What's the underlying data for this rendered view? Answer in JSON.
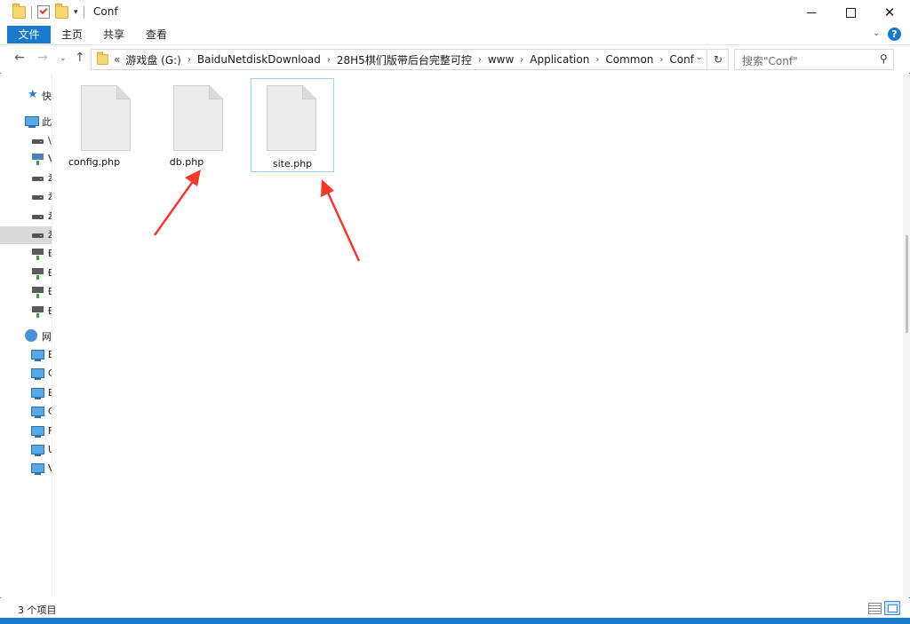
{
  "window": {
    "title": "Conf"
  },
  "ribbon": {
    "file_tab": "文件",
    "tabs": [
      "主页",
      "共享",
      "查看"
    ],
    "help": "?"
  },
  "nav": {
    "breadcrumbs": [
      "游戏盘 (G:)",
      "BaiduNetdiskDownload",
      "28H5棋们版带后台完整可控",
      "www",
      "Application",
      "Common",
      "Conf"
    ],
    "prefix": "«"
  },
  "search": {
    "placeholder": "搜索\"Conf\""
  },
  "sidebar": {
    "items": [
      {
        "label": "快",
        "icon": "star-icon"
      },
      {
        "label": "此",
        "icon": "computer-icon"
      },
      {
        "label": "\\",
        "icon": "drive-icon"
      },
      {
        "label": "V",
        "icon": "drive-icon"
      },
      {
        "label": "ž",
        "icon": "drive-icon"
      },
      {
        "label": "ž",
        "icon": "drive-icon"
      },
      {
        "label": "ž",
        "icon": "drive-icon"
      },
      {
        "label": "ž",
        "icon": "drive-icon"
      },
      {
        "label": "Ð",
        "icon": "network-drive-icon"
      },
      {
        "label": "Ð",
        "icon": "network-drive-icon"
      },
      {
        "label": "Ð",
        "icon": "network-drive-icon"
      },
      {
        "label": "Ð",
        "icon": "network-drive-icon"
      },
      {
        "label": "网",
        "icon": "network-icon"
      },
      {
        "label": "E",
        "icon": "monitor-icon"
      },
      {
        "label": "C",
        "icon": "monitor-icon"
      },
      {
        "label": "E",
        "icon": "monitor-icon"
      },
      {
        "label": "C",
        "icon": "monitor-icon"
      },
      {
        "label": "F",
        "icon": "monitor-icon"
      },
      {
        "label": "U",
        "icon": "monitor-icon"
      },
      {
        "label": "V",
        "icon": "monitor-icon"
      }
    ]
  },
  "files": [
    {
      "name": "config.php"
    },
    {
      "name": "db.php"
    },
    {
      "name": "site.php"
    }
  ],
  "status": {
    "text": "3 个项目"
  },
  "colors": {
    "accent": "#1979ca",
    "annotation": "#f03a2e",
    "selection_border": "#99d1ff"
  }
}
